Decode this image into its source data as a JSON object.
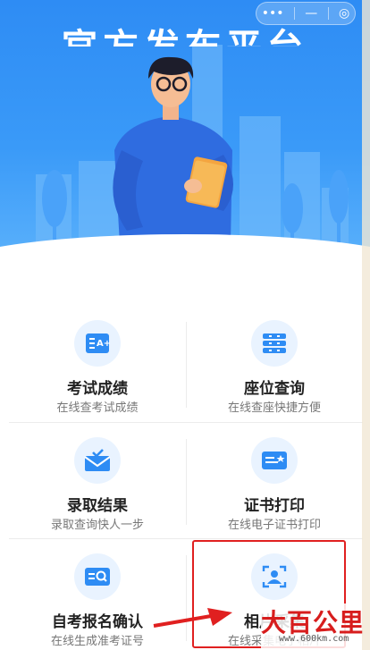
{
  "hero": {
    "title": "官方发布平台"
  },
  "capsule": {
    "more": "•••",
    "min": "—",
    "close": "◎"
  },
  "services": [
    {
      "title": "考试成绩",
      "subtitle": "在线查考试成绩",
      "icon": "grade-report-icon"
    },
    {
      "title": "座位查询",
      "subtitle": "在线查座快捷方便",
      "icon": "seat-icon"
    },
    {
      "title": "录取结果",
      "subtitle": "录取查询快人一步",
      "icon": "admission-envelope-icon"
    },
    {
      "title": "证书打印",
      "subtitle": "在线电子证书打印",
      "icon": "certificate-icon"
    },
    {
      "title": "自考报名确认",
      "subtitle": "在线生成准考证号",
      "icon": "search-doc-icon"
    },
    {
      "title": "相片采集",
      "subtitle": "在线采集电子相片",
      "icon": "photo-capture-icon"
    }
  ],
  "watermark": {
    "logo": "大百公里",
    "url": "www.600km.com"
  },
  "colors": {
    "primary": "#2e8cf4",
    "highlight": "#e02020"
  }
}
